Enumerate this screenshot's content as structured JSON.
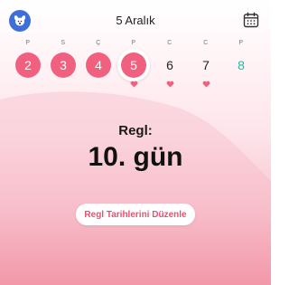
{
  "header": {
    "title": "5 Aralık",
    "avatar_icon": "dog-avatar-icon",
    "calendar_icon": "calendar-icon"
  },
  "week": {
    "day_labels": [
      "P",
      "S",
      "Ç",
      "P",
      "C",
      "C",
      "P"
    ],
    "days": [
      {
        "num": "2",
        "state": "period"
      },
      {
        "num": "3",
        "state": "period"
      },
      {
        "num": "4",
        "state": "period"
      },
      {
        "num": "5",
        "state": "today-period"
      },
      {
        "num": "6",
        "state": "plain"
      },
      {
        "num": "7",
        "state": "plain"
      },
      {
        "num": "8",
        "state": "fertile"
      }
    ],
    "heart_color": "#f2607f"
  },
  "status": {
    "label": "Regl:",
    "value": "10. gün"
  },
  "actions": {
    "edit_label": "Regl Tarihlerini Düzenle"
  },
  "colors": {
    "accent": "#f2607f",
    "fertile": "#2bb5a0",
    "avatar_bg": "#3e6fd8"
  }
}
